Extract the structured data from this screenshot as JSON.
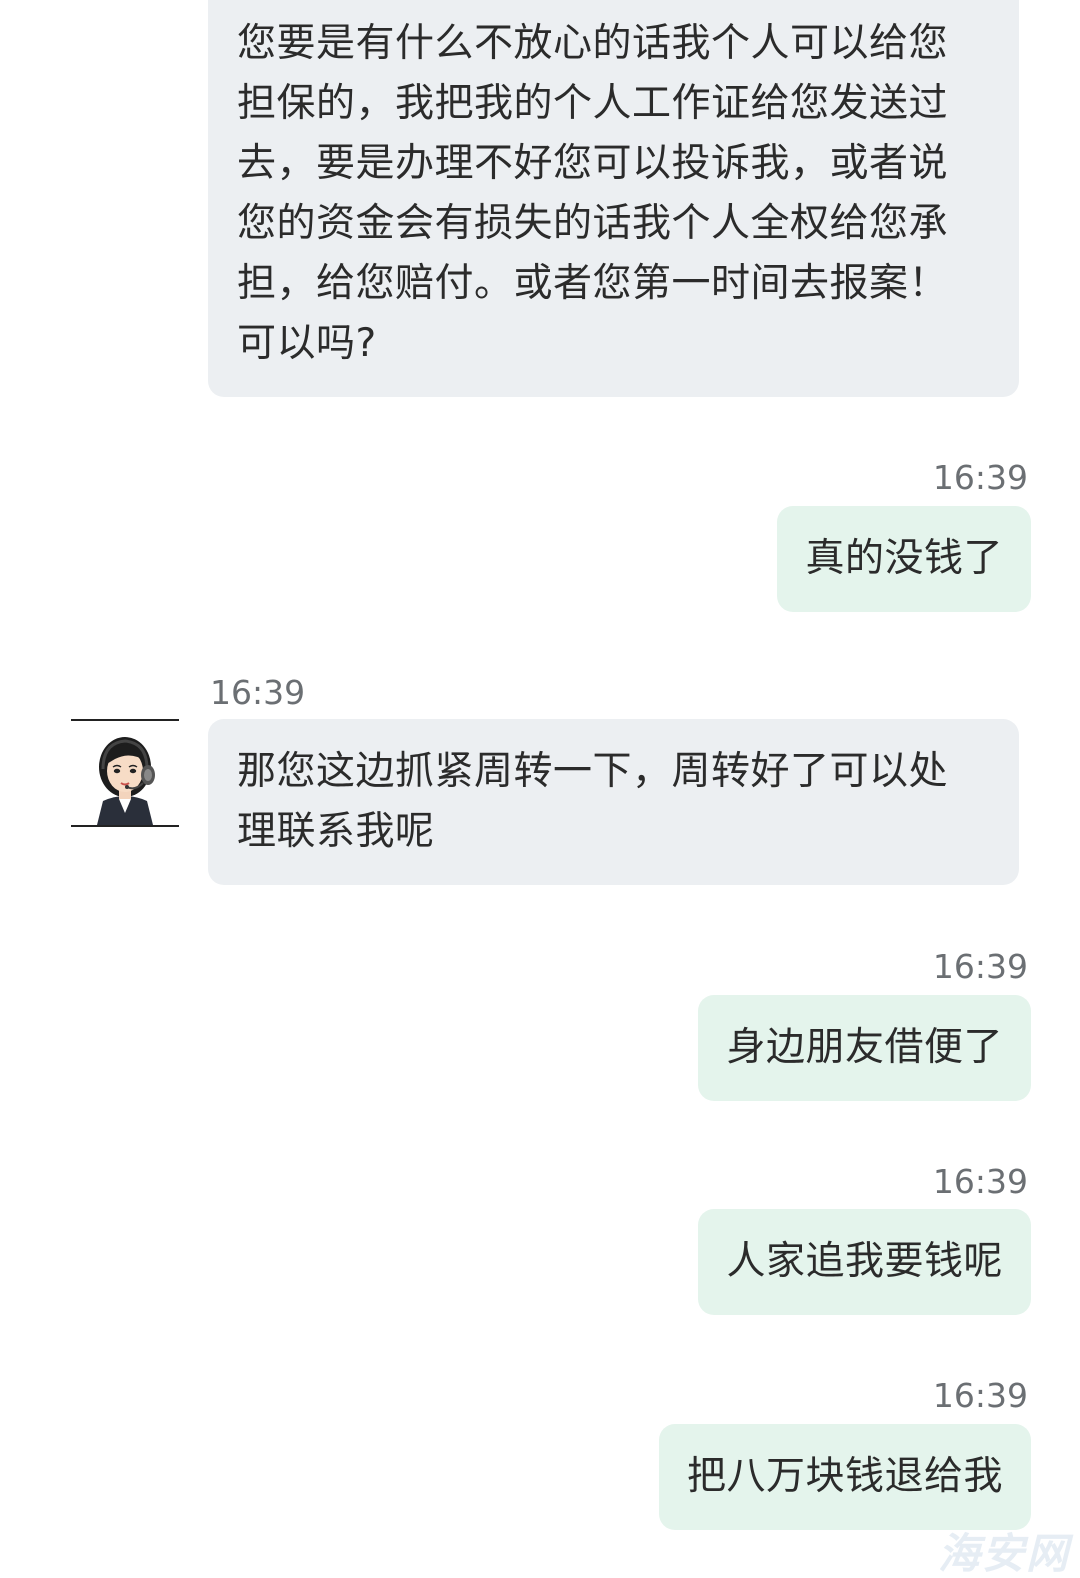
{
  "messages": [
    {
      "id": "m1",
      "sender": "agent",
      "lines": [
        "您要是有什么不放心的话我个人可以给您",
        "担保的，我把我的个人工作证给您发送过",
        "去，要是办理不好您可以投诉我，或者说",
        "您的资金会有损失的话我个人全权给您承",
        "担，给您赔付。或者您第一时间去报案！",
        "可以吗?"
      ]
    },
    {
      "id": "m2",
      "sender": "user",
      "time": "16:39",
      "lines": [
        "真的没钱了"
      ]
    },
    {
      "id": "m3",
      "sender": "agent",
      "time": "16:39",
      "lines": [
        "那您这边抓紧周转一下，周转好了可以处",
        "理联系我呢"
      ]
    },
    {
      "id": "m4",
      "sender": "user",
      "time": "16:39",
      "lines": [
        "身边朋友借便了"
      ]
    },
    {
      "id": "m5",
      "sender": "user",
      "time": "16:39",
      "lines": [
        "人家追我要钱呢"
      ]
    },
    {
      "id": "m6",
      "sender": "user",
      "time": "16:39",
      "lines": [
        "把八万块钱退给我"
      ]
    }
  ],
  "avatar": {
    "icon": "customer-service-agent-avatar-icon"
  },
  "watermark": {
    "text": "海安网"
  },
  "colors": {
    "incoming_bubble": "#eceff2",
    "outgoing_bubble": "#e4f4ec",
    "timestamp": "#6b6f73",
    "text": "#2b2b2b"
  }
}
